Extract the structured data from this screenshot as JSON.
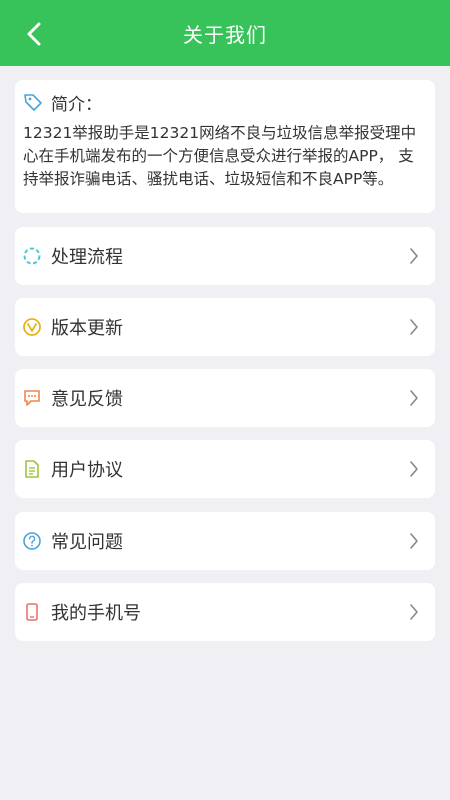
{
  "header": {
    "title": "关于我们"
  },
  "intro": {
    "title": "简介：",
    "text": "12321举报助手是12321网络不良与垃圾信息举报受理中心在手机端发布的一个方便信息受众进行举报的APP， 支持举报诈骗电话、骚扰电话、垃圾短信和不良APP等。"
  },
  "menu": [
    {
      "label": "处理流程",
      "icon": "process-icon",
      "color": "#4ac8d6"
    },
    {
      "label": "版本更新",
      "icon": "version-icon",
      "color": "#e8b41c"
    },
    {
      "label": "意见反馈",
      "icon": "feedback-icon",
      "color": "#f1864a"
    },
    {
      "label": "用户协议",
      "icon": "agreement-icon",
      "color": "#9fc33a"
    },
    {
      "label": "常见问题",
      "icon": "question-icon",
      "color": "#4aa3dd"
    },
    {
      "label": "我的手机号",
      "icon": "phone-icon",
      "color": "#ef6f6f"
    }
  ],
  "colors": {
    "brand": "#37c25a",
    "background": "#efeff4"
  }
}
